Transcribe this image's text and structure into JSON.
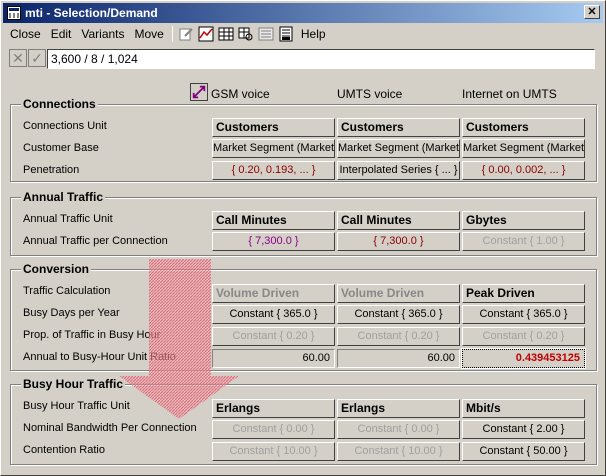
{
  "window": {
    "title": "mti - Selection/Demand",
    "close_glyph": "✕"
  },
  "menu": {
    "close": "Close",
    "edit": "Edit",
    "variants": "Variants",
    "move": "Move",
    "help": "Help"
  },
  "editor": {
    "value": "3,600 / 8 / 1,024"
  },
  "columns": [
    "GSM voice",
    "UMTS voice",
    "Internet on UMTS"
  ],
  "connections": {
    "title": "Connections",
    "labels": [
      "Connections Unit",
      "Customer Base",
      "Penetration"
    ],
    "unit": [
      "Customers",
      "Customers",
      "Customers"
    ],
    "base": [
      "Market Segment (Market)",
      "Market Segment (Market)",
      "Market Segment (Market)"
    ],
    "penetration": [
      "{ 0.20, 0.193, ... }",
      "Interpolated Series { ... }",
      "{ 0.00, 0.002, ... }"
    ]
  },
  "traffic": {
    "title": "Annual Traffic",
    "labels": [
      "Annual Traffic Unit",
      "Annual Traffic per Connection"
    ],
    "unit": [
      "Call Minutes",
      "Call Minutes",
      "Gbytes"
    ],
    "per_conn": [
      "{ 7,300.0 }",
      "{ 7,300.0 }",
      "Constant { 1.00 }"
    ]
  },
  "conversion": {
    "title": "Conversion",
    "labels": [
      "Traffic Calculation",
      "Busy Days per Year",
      "Prop. of Traffic in Busy Hour",
      "Annual to Busy-Hour Unit Ratio"
    ],
    "calc": [
      "Volume Driven",
      "Volume Driven",
      "Peak Driven"
    ],
    "days": [
      "Constant { 365.0 }",
      "Constant { 365.0 }",
      "Constant { 365.0 }"
    ],
    "prop": [
      "Constant { 0.20 }",
      "Constant { 0.20 }",
      "Constant { 0.20 }"
    ],
    "ratio": [
      "60.00",
      "60.00",
      "0.439453125"
    ]
  },
  "busy": {
    "title": "Busy Hour Traffic",
    "labels": [
      "Busy Hour Traffic Unit",
      "Nominal Bandwidth Per Connection",
      "Contention Ratio"
    ],
    "unit": [
      "Erlangs",
      "Erlangs",
      "Mbit/s"
    ],
    "bandwidth": [
      "Constant { 0.00 }",
      "Constant { 0.00 }",
      "Constant { 2.00 }"
    ],
    "contention": [
      "Constant { 10.00 }",
      "Constant { 10.00 }",
      "Constant { 50.00 }"
    ]
  },
  "colors": {
    "accent": "#0a246a",
    "red": "#8b0000",
    "arrow": "#e86a7a"
  }
}
